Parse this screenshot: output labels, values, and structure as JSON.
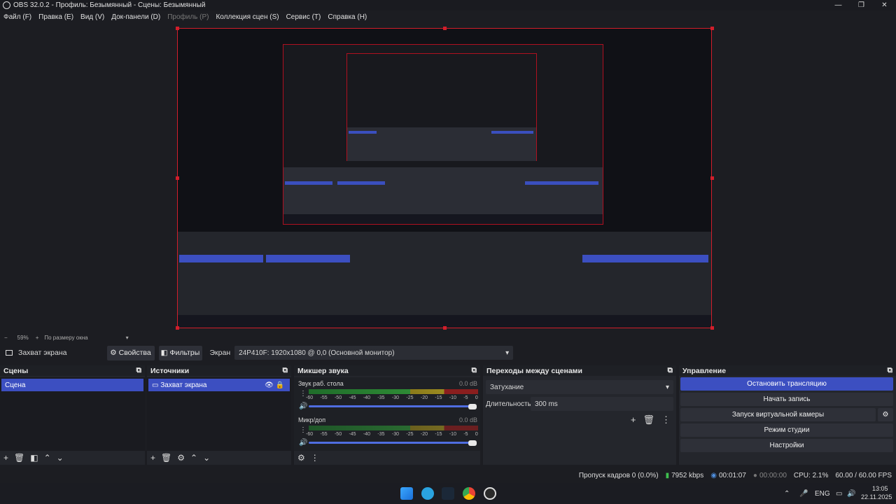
{
  "window": {
    "title": "OBS 32.0.2 - Профиль: Безымянный - Сцены: Безымянный"
  },
  "menu": [
    "Файл (F)",
    "Правка (E)",
    "Вид (V)",
    "Док-панели (D)",
    "Профиль (P)",
    "Коллекция сцен (S)",
    "Сервис (T)",
    "Справка (H)"
  ],
  "preview": {
    "zoom": "59%",
    "zoom_mode": "По размеру окна"
  },
  "source_bar": {
    "source": "Захват экрана",
    "properties": "Свойства",
    "filters": "Фильтры",
    "screen_label": "Экран",
    "screen_value": "24P410F: 1920x1080 @ 0,0 (Основной монитор)"
  },
  "scenes": {
    "title": "Сцены",
    "items": [
      "Сцена"
    ]
  },
  "sources": {
    "title": "Источники",
    "items": [
      "Захват экрана"
    ]
  },
  "mixer": {
    "title": "Микшер звука",
    "scale": [
      "-60",
      "-55",
      "-50",
      "-45",
      "-40",
      "-35",
      "-30",
      "-25",
      "-20",
      "-15",
      "-10",
      "-5",
      "0"
    ],
    "channels": [
      {
        "name": "Звук раб. стола",
        "db": "0.0 dB",
        "level": 0.63,
        "volume": 1.0
      },
      {
        "name": "Микр/доп",
        "db": "0.0 dB",
        "level": 0.0,
        "volume": 1.0
      }
    ]
  },
  "transitions": {
    "title": "Переходы между сценами",
    "selected": "Затухание",
    "duration_label": "Длительность",
    "duration_value": "300 ms"
  },
  "controls": {
    "title": "Управление",
    "stop_stream": "Остановить трансляцию",
    "start_record": "Начать запись",
    "virtual_cam": "Запуск виртуальной камеры",
    "studio_mode": "Режим студии",
    "settings": "Настройки"
  },
  "status": {
    "dropped": "Пропуск кадров 0 (0.0%)",
    "bitrate": "7952 kbps",
    "stream_time": "00:01:07",
    "rec_time": "00:00:00",
    "cpu": "CPU: 2.1%",
    "fps": "60.00 / 60.00 FPS"
  },
  "tray": {
    "lang": "ENG",
    "time": "13:05",
    "date": "22.11.2025"
  },
  "colors": {
    "accent": "#3c4fc1",
    "selection_border": "#d21e2b"
  }
}
